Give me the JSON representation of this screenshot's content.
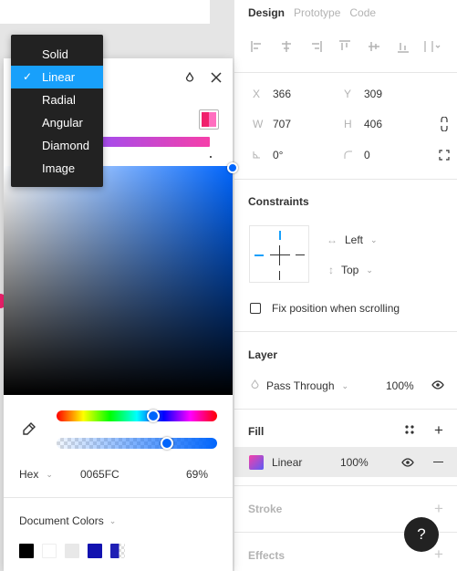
{
  "props": {
    "tabs": [
      "Design",
      "Prototype",
      "Code"
    ],
    "align_icons": [
      "align-left-icon",
      "align-horizontal-center-icon",
      "align-right-icon",
      "align-top-icon",
      "align-vertical-center-icon",
      "align-bottom-icon",
      "distribute-icon"
    ],
    "x_label": "X",
    "x_value": "366",
    "y_label": "Y",
    "y_value": "309",
    "w_label": "W",
    "w_value": "707",
    "h_label": "H",
    "h_value": "406",
    "rotation_value": "0°",
    "radius_value": "0",
    "constraints": {
      "title": "Constraints",
      "horizontal": "Left",
      "vertical": "Top",
      "fix_position_label": "Fix position when scrolling"
    },
    "layer": {
      "title": "Layer",
      "blend_mode": "Pass Through",
      "opacity": "100%"
    },
    "fill": {
      "title": "Fill",
      "type": "Linear",
      "opacity": "100%"
    },
    "stroke_title": "Stroke",
    "effects_title": "Effects",
    "help_label": "?"
  },
  "picker": {
    "type_menu": {
      "items": [
        "Solid",
        "Linear",
        "Radial",
        "Angular",
        "Diamond",
        "Image"
      ],
      "selected": "Linear"
    },
    "color_model": "Hex",
    "hex_value": "0065FC",
    "alpha": "69%",
    "hue_fraction": 0.6,
    "alpha_fraction": 0.69,
    "document_colors_title": "Document Colors",
    "document_colors": [
      "#000000",
      "#ffffff",
      "#e8e8e8",
      "#1212b0",
      "#2020b5"
    ],
    "current_color": "#0065FC"
  },
  "colors": {
    "accent": "#18a0fb",
    "menu_bg": "#222222",
    "canvas": "#e5e5e5"
  }
}
